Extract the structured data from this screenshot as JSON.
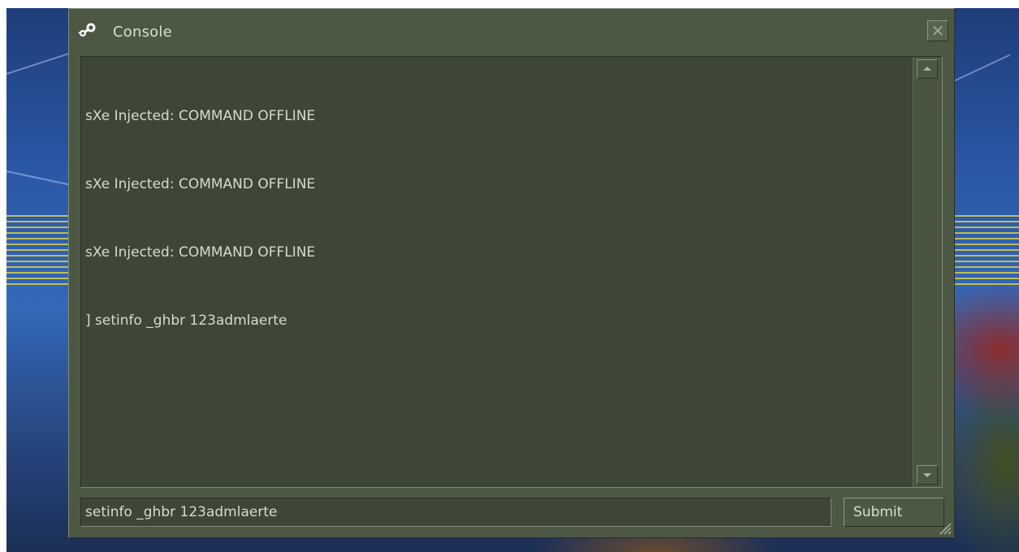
{
  "window": {
    "title": "Console",
    "title_icon": "steam-icon",
    "close_icon": "close-icon"
  },
  "output": {
    "lines": [
      "sXe Injected: COMMAND OFFLINE",
      "sXe Injected: COMMAND OFFLINE",
      "sXe Injected: COMMAND OFFLINE",
      "] setinfo _ghbr 123admlaerte"
    ]
  },
  "input": {
    "value": "setinfo _ghbr 123admlaerte"
  },
  "submit": {
    "label": "Submit"
  },
  "colors": {
    "window_bg": "#4c5844",
    "panel_bg": "#3e4637",
    "text": "#d5dccc"
  }
}
